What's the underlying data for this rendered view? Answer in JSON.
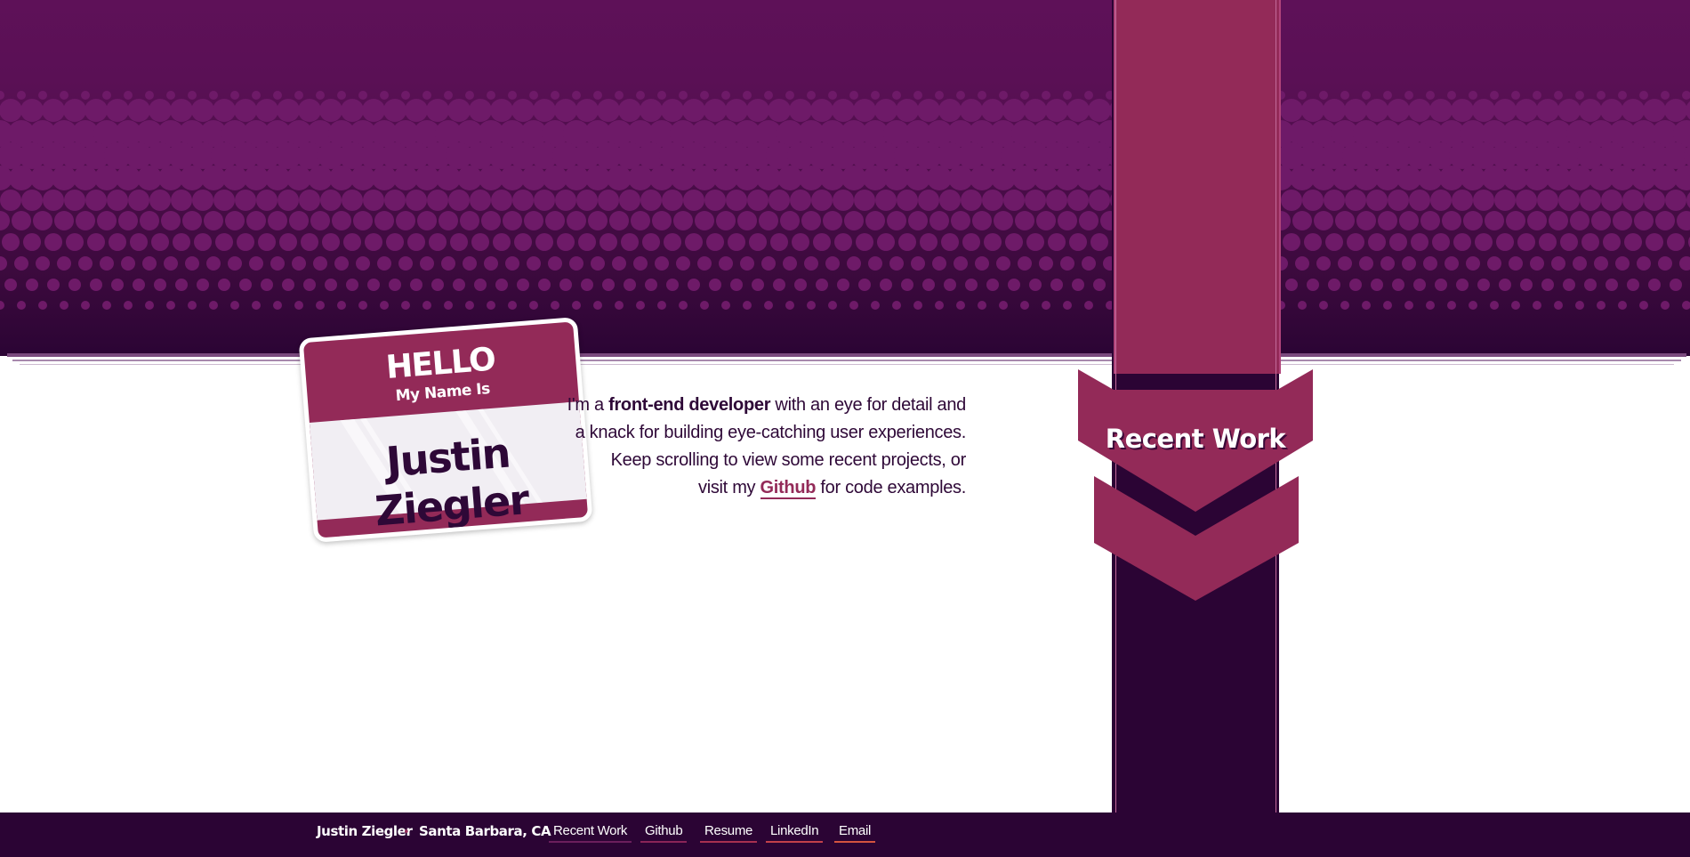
{
  "nametag": {
    "hello": "HELLO",
    "subtitle": "My Name Is",
    "name": "Justin Ziegler"
  },
  "intro": {
    "prefix": "I'm a ",
    "highlight": "front-end developer",
    "line1_rest": " with an eye for detail and",
    "line2": "a knack for building eye-catching user experiences.",
    "line3": "Keep scrolling to view some recent projects, or",
    "line4_prefix": "visit my ",
    "link": "Github",
    "line4_suffix": " for code examples."
  },
  "ribbon": {
    "label": "Recent Work"
  },
  "footer": {
    "name": "Justin Ziegler",
    "separator": "•",
    "location": "Santa Barbara, CA",
    "links": [
      "Recent Work",
      "Github",
      "Resume",
      "LinkedIn",
      "Email"
    ],
    "link_underline_colors": [
      "#6b1f5c",
      "#8a2457",
      "#a83050",
      "#c2404a",
      "#d4543f"
    ]
  },
  "colors": {
    "hero_top": "#5e1158",
    "hero_bottom": "#2b0434",
    "accent": "#932a58",
    "dark": "#2b0434",
    "text": "#2e0837"
  }
}
